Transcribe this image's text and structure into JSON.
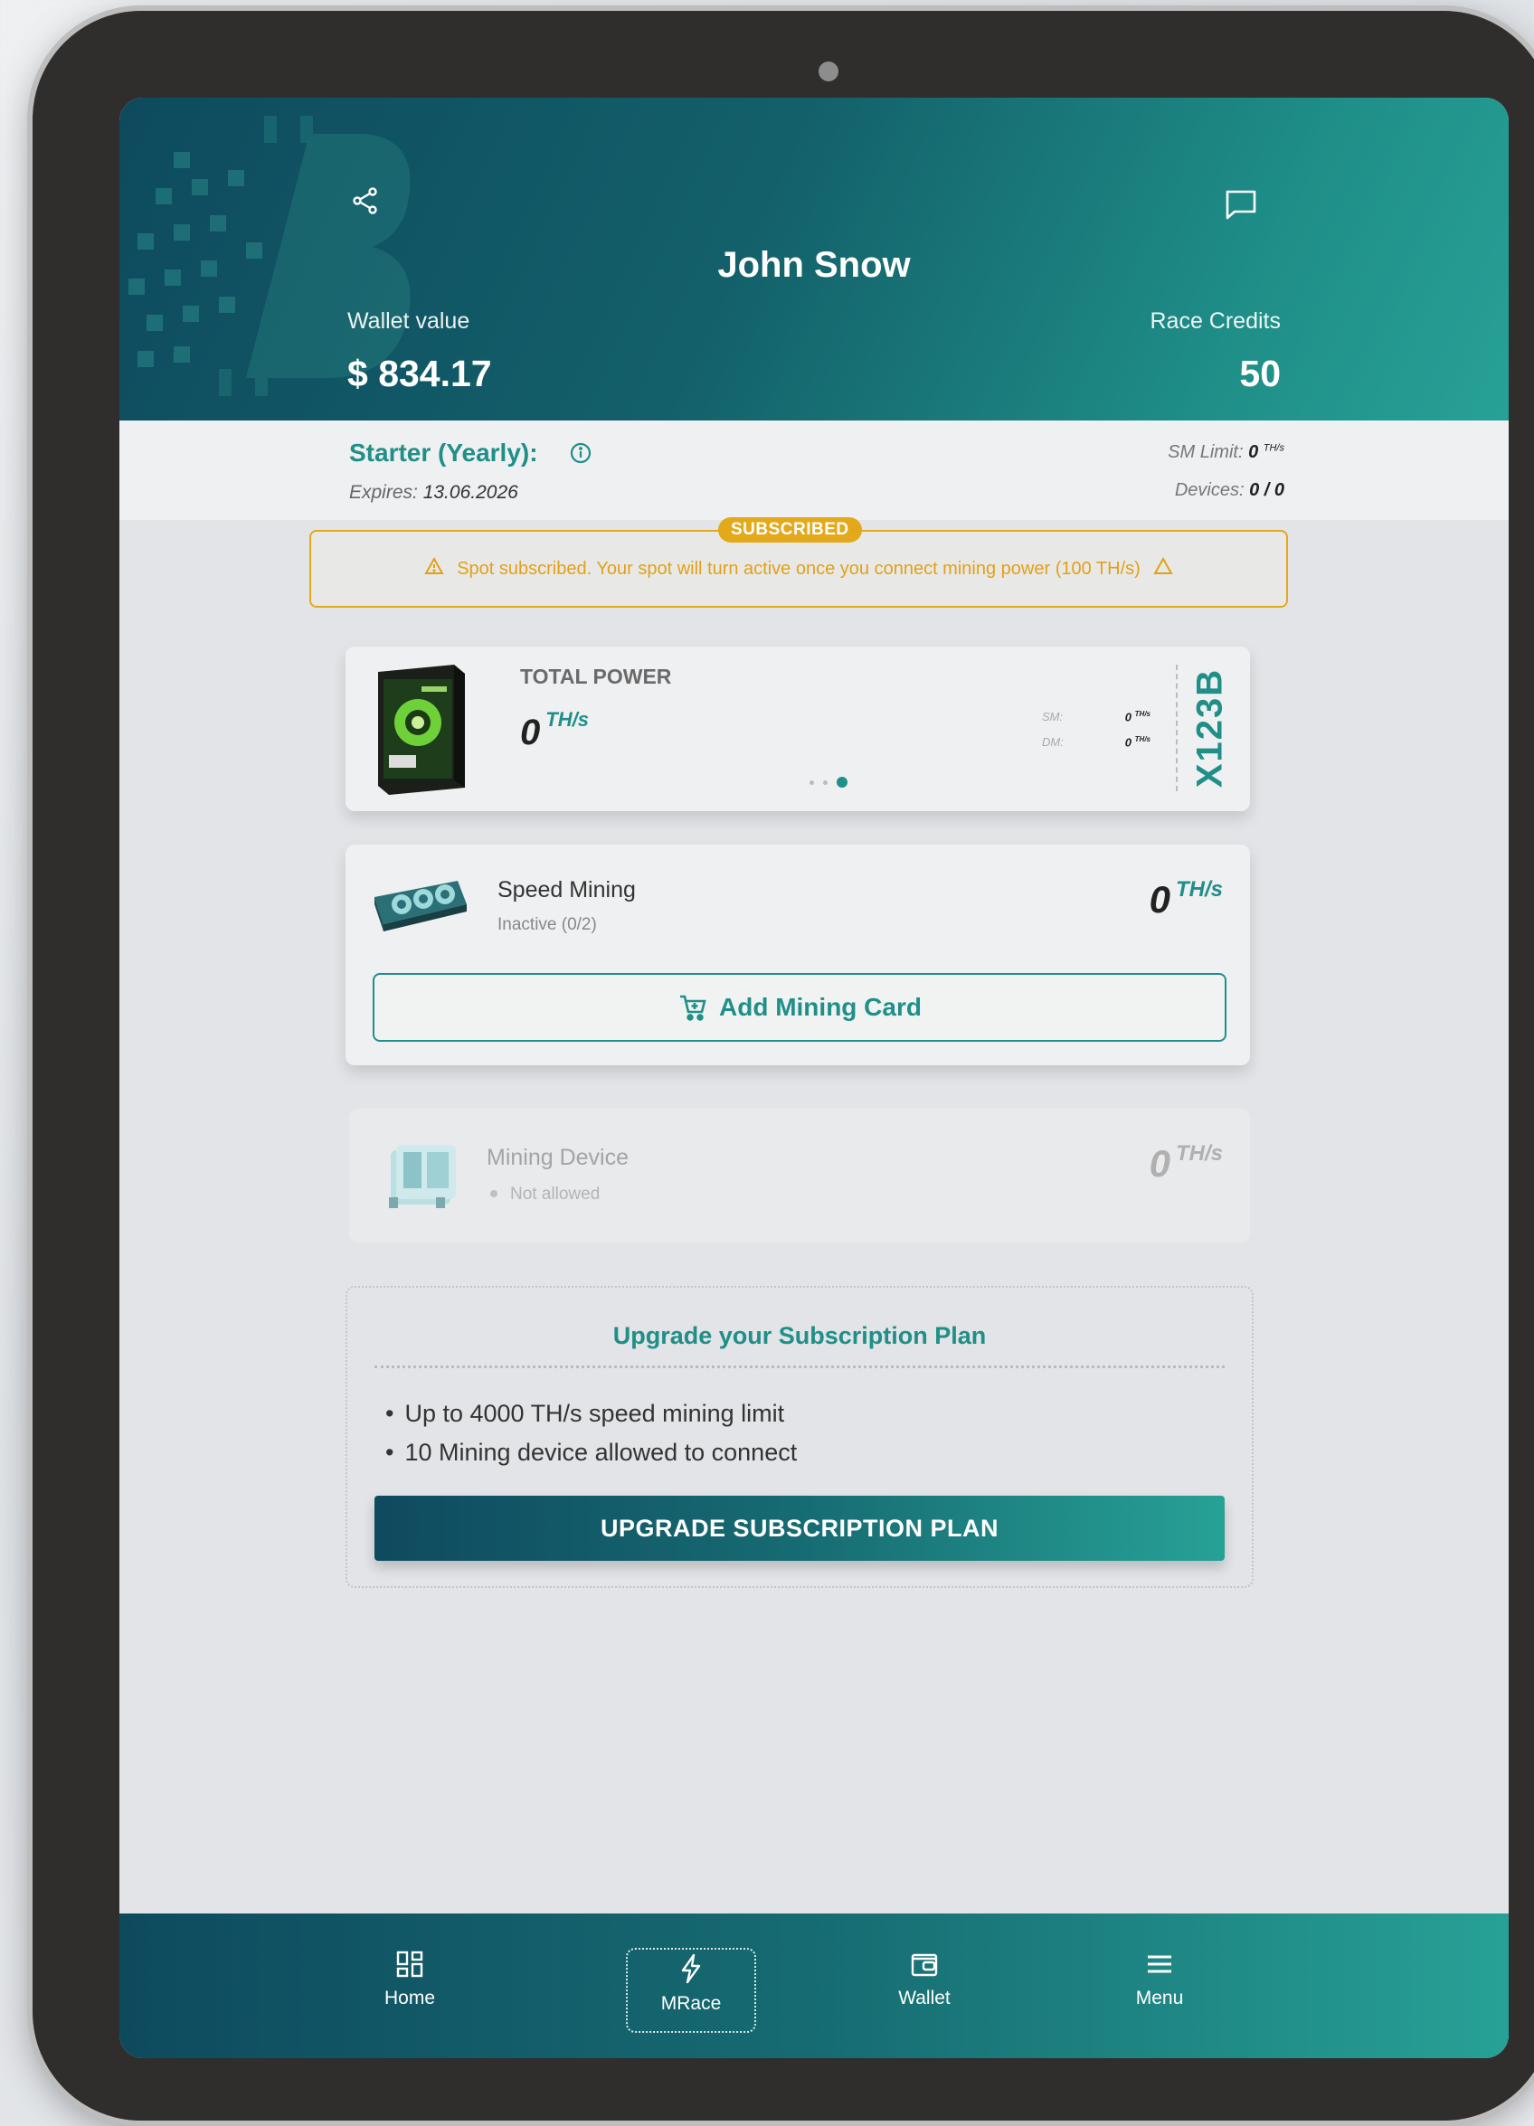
{
  "header": {
    "user_name": "John Snow",
    "wallet_label": "Wallet value",
    "wallet_value": "$ 834.17",
    "credits_label": "Race Credits",
    "credits_value": "50",
    "share_icon": "share-icon",
    "chat_icon": "chat-icon"
  },
  "plan": {
    "name": "Starter (Yearly):",
    "expires_label": "Expires:",
    "expires_value": "13.06.2026",
    "sm_limit_label": "SM Limit:",
    "sm_limit_value": "0",
    "sm_limit_unit": "TH/s",
    "devices_label": "Devices:",
    "devices_value": "0 / 0"
  },
  "notice": {
    "badge": "SUBSCRIBED",
    "text": "Spot subscribed. Your spot will turn active once you connect mining power (100 TH/s)",
    "color": "#e4a91b"
  },
  "total_power": {
    "label": "TOTAL POWER",
    "value": "0",
    "unit": "TH/s",
    "sm_label": "SM:",
    "sm_value": "0",
    "dm_label": "DM:",
    "dm_value": "0",
    "mini_unit": "TH/s",
    "code": "X123B"
  },
  "speed_mining": {
    "title": "Speed Mining",
    "status": "Inactive (0/2)",
    "value": "0",
    "unit": "TH/s",
    "add_button": "Add Mining Card"
  },
  "mining_device": {
    "title": "Mining Device",
    "status": "Not allowed",
    "value": "0",
    "unit": "TH/s"
  },
  "upgrade": {
    "title": "Upgrade your Subscription Plan",
    "features": [
      "Up to 4000 TH/s speed mining limit",
      "10 Mining device allowed to connect"
    ],
    "button": "UPGRADE SUBSCRIPTION PLAN"
  },
  "nav": {
    "items": [
      {
        "label": "Home",
        "icon": "home-grid-icon"
      },
      {
        "label": "MRace",
        "icon": "bolt-icon"
      },
      {
        "label": "Wallet",
        "icon": "wallet-icon"
      },
      {
        "label": "Menu",
        "icon": "menu-icon"
      }
    ]
  },
  "colors": {
    "accent": "#1f8f88",
    "header_dark": "#0e4a5e",
    "warning": "#e4a91b"
  }
}
